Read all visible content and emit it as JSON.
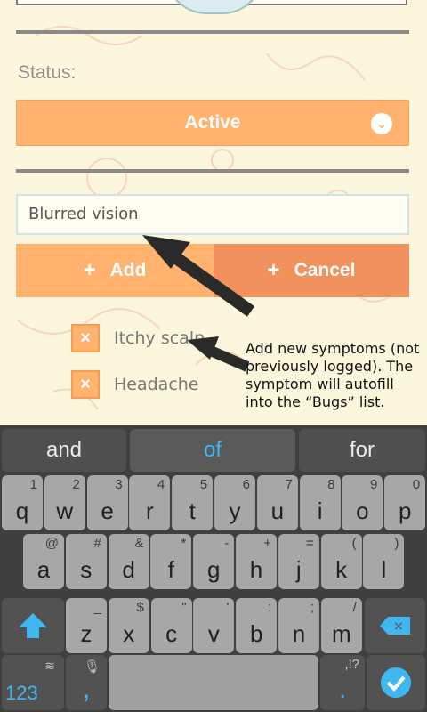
{
  "status": {
    "label": "Status:",
    "selected": "Active",
    "chevron_icon": "chevron-down-icon"
  },
  "symptom": {
    "value": "Blurred vision"
  },
  "buttons": {
    "add_label": "Add",
    "cancel_label": "Cancel",
    "plus_glyph": "+"
  },
  "symptoms_list": [
    {
      "label": "Itchy scalp",
      "checked_glyph": "×"
    },
    {
      "label": "Headache",
      "checked_glyph": "×"
    }
  ],
  "annotation": {
    "text": "Add new symptoms (not previously logged). The symptom will autofill into the “Bugs” list."
  },
  "keyboard": {
    "suggestions": [
      "and",
      "of",
      "for"
    ],
    "row1": [
      {
        "main": "q",
        "alt": "1"
      },
      {
        "main": "w",
        "alt": "2"
      },
      {
        "main": "e",
        "alt": "3"
      },
      {
        "main": "r",
        "alt": "4"
      },
      {
        "main": "t",
        "alt": "5"
      },
      {
        "main": "y",
        "alt": "6"
      },
      {
        "main": "u",
        "alt": "7"
      },
      {
        "main": "i",
        "alt": "8"
      },
      {
        "main": "o",
        "alt": "9"
      },
      {
        "main": "p",
        "alt": "0"
      }
    ],
    "row2": [
      {
        "main": "a",
        "alt": "@"
      },
      {
        "main": "s",
        "alt": "#"
      },
      {
        "main": "d",
        "alt": "&"
      },
      {
        "main": "f",
        "alt": "*"
      },
      {
        "main": "g",
        "alt": "-"
      },
      {
        "main": "h",
        "alt": "+"
      },
      {
        "main": "j",
        "alt": "="
      },
      {
        "main": "k",
        "alt": "("
      },
      {
        "main": "l",
        "alt": ")"
      }
    ],
    "row3": [
      {
        "main": "z",
        "alt": "_"
      },
      {
        "main": "x",
        "alt": "$"
      },
      {
        "main": "c",
        "alt": "\""
      },
      {
        "main": "v",
        "alt": "'"
      },
      {
        "main": "b",
        "alt": ":"
      },
      {
        "main": "n",
        "alt": ";"
      },
      {
        "main": "m",
        "alt": "/"
      }
    ],
    "numbers_key": "123",
    "comma_key": ",",
    "period_key": ".",
    "punct_alt": ",!?",
    "accent_color": "#40b7f0",
    "shift_icon": "shift-arrow-icon",
    "backspace_icon": "backspace-icon",
    "enter_icon": "checkmark-icon",
    "swype_icon": "swype-logo-icon",
    "mic_icon": "microphone-icon"
  }
}
